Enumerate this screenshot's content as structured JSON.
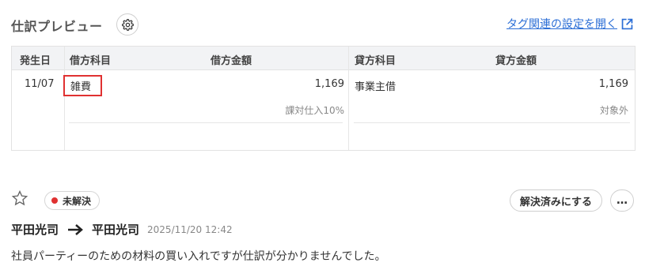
{
  "header": {
    "title": "仕訳プレビュー",
    "settings_icon": "gear-icon",
    "settings_link": "タグ関連の設定を開く",
    "external_icon": "external-link-icon",
    "link_color": "#2b6ed6"
  },
  "journal_table": {
    "columns": [
      "発生日",
      "借方科目",
      "借方金額",
      "貸方科目",
      "貸方金額"
    ],
    "rows": [
      {
        "date": "11/07",
        "debit_account": "雑費",
        "debit_amount": "1,169",
        "debit_tax": "課対仕入10%",
        "credit_account": "事業主借",
        "credit_amount": "1,169",
        "credit_tax": "対象外"
      }
    ],
    "highlight_color": "#e03131"
  },
  "comment": {
    "star_icon": "star-outline-icon",
    "status": "未解決",
    "status_color": "#e03131",
    "resolve_label": "解決済みにする",
    "more_label": "…",
    "from": "平田光司",
    "to": "平田光司",
    "arrow_icon": "arrow-right-icon",
    "timestamp": "2025/11/20 12:42",
    "text": "社員パーティーのための材料の買い入れですが仕訳が分かりませんでした。"
  }
}
